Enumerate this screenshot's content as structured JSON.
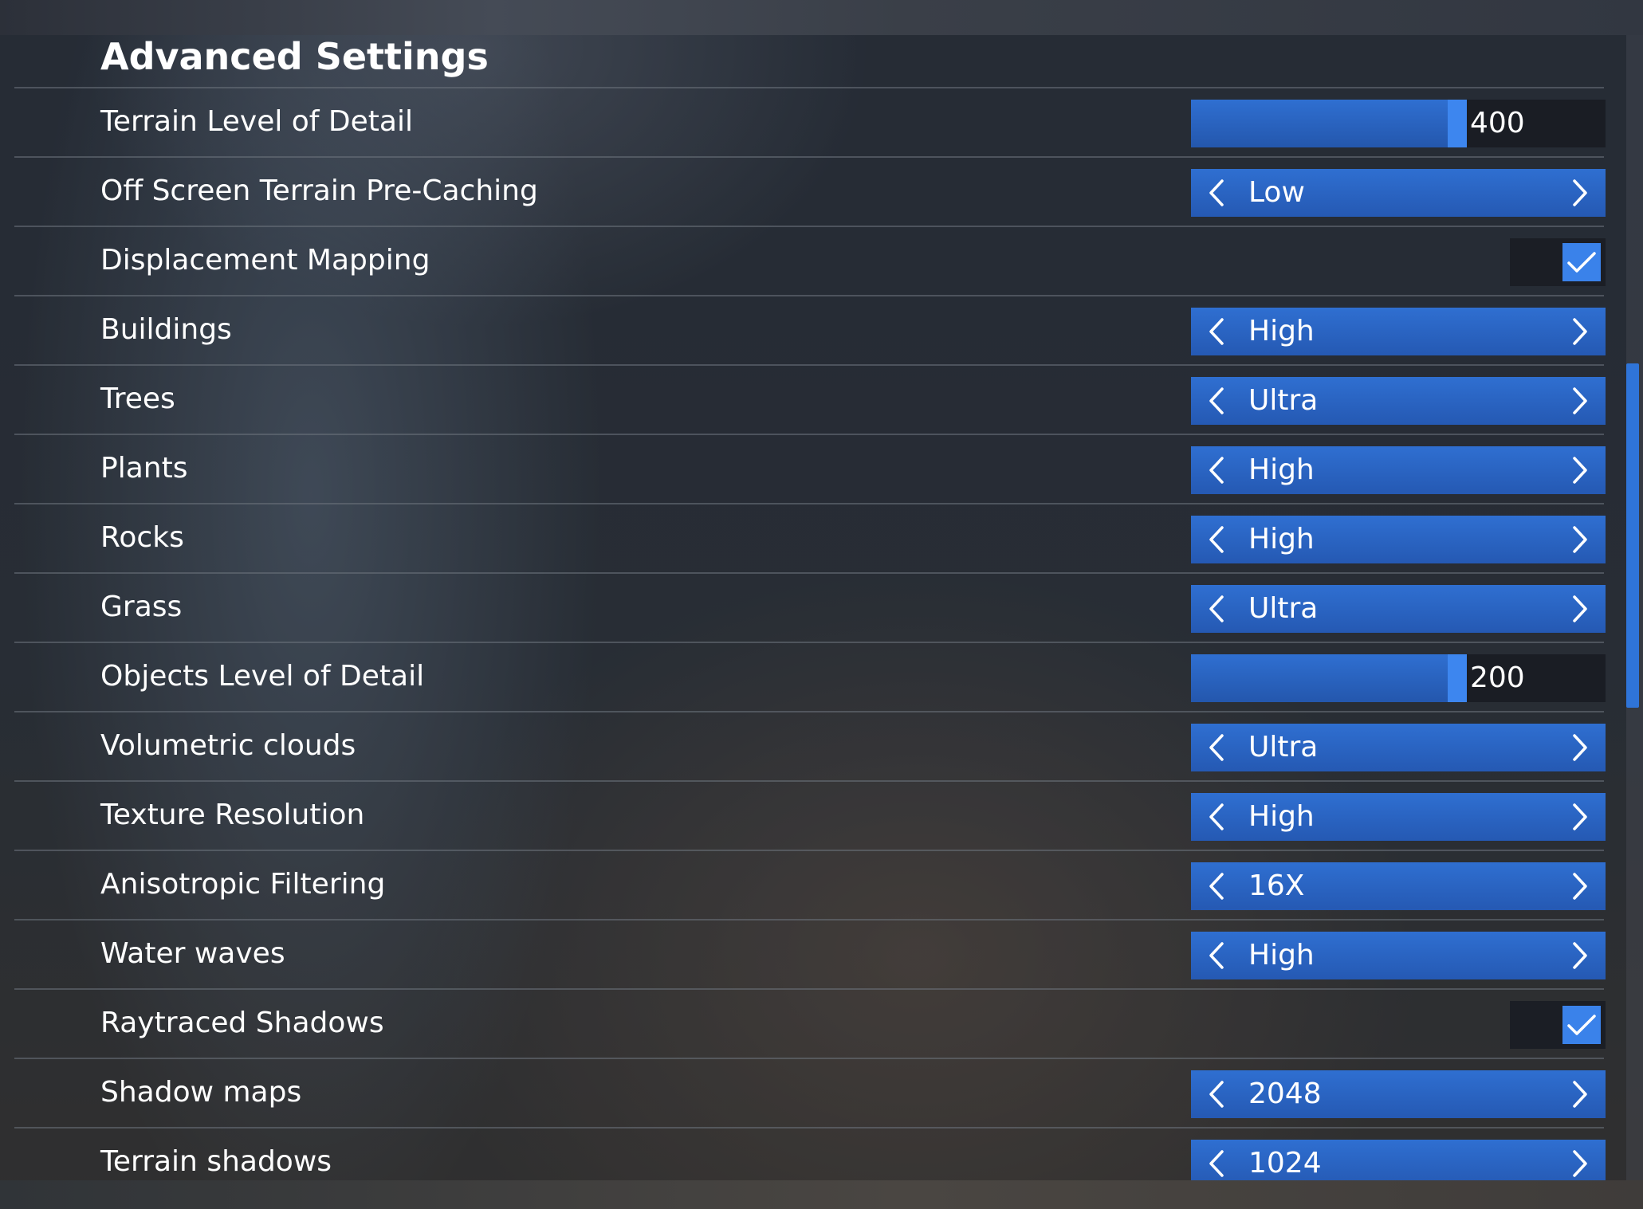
{
  "title": "Advanced Settings",
  "rows": [
    {
      "label": "Terrain Level of Detail",
      "type": "slider",
      "value": "400",
      "fill_fraction": 0.62
    },
    {
      "label": "Off Screen Terrain Pre-Caching",
      "type": "selector",
      "value": "Low"
    },
    {
      "label": "Displacement Mapping",
      "type": "toggle",
      "checked": true
    },
    {
      "label": "Buildings",
      "type": "selector",
      "value": "High"
    },
    {
      "label": "Trees",
      "type": "selector",
      "value": "Ultra"
    },
    {
      "label": "Plants",
      "type": "selector",
      "value": "High"
    },
    {
      "label": "Rocks",
      "type": "selector",
      "value": "High"
    },
    {
      "label": "Grass",
      "type": "selector",
      "value": "Ultra"
    },
    {
      "label": "Objects Level of Detail",
      "type": "slider",
      "value": "200",
      "fill_fraction": 0.62
    },
    {
      "label": "Volumetric clouds",
      "type": "selector",
      "value": "Ultra"
    },
    {
      "label": "Texture Resolution",
      "type": "selector",
      "value": "High"
    },
    {
      "label": "Anisotropic Filtering",
      "type": "selector",
      "value": "16X"
    },
    {
      "label": "Water waves",
      "type": "selector",
      "value": "High"
    },
    {
      "label": "Raytraced Shadows",
      "type": "toggle",
      "checked": true
    },
    {
      "label": "Shadow maps",
      "type": "selector",
      "value": "2048"
    },
    {
      "label": "Terrain shadows",
      "type": "selector",
      "value": "1024"
    }
  ],
  "scrollbar": {
    "position_fraction": 0.32
  },
  "colors": {
    "accent": "#2f6fd1",
    "slider_handle": "#3d86ef",
    "checkbox": "#3a82ea",
    "text": "#ffffff"
  },
  "icons": {
    "prev": "chevron-left-icon",
    "next": "chevron-right-icon",
    "check": "checkmark-icon"
  }
}
